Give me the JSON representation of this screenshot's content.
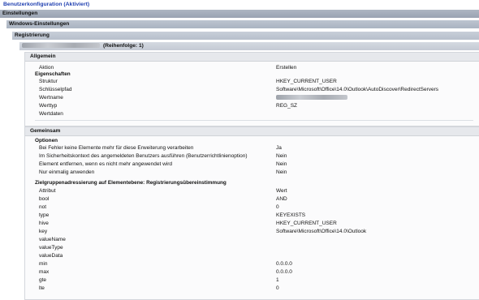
{
  "title": "Benutzerkonfiguration (Aktiviert)",
  "bands": {
    "einstellungen": "Einstellungen",
    "windows": "Windows-Einstellungen",
    "registrierung": "Registrierung",
    "item_suffix": "(Reihenfolge: 1)"
  },
  "allgemein": {
    "heading": "Allgemein",
    "aktion_label": "Aktion",
    "aktion_value": "Erstellen",
    "eigenschaften_heading": "Eigenschaften",
    "rows": [
      {
        "label": "Struktur",
        "value": "HKEY_CURRENT_USER"
      },
      {
        "label": "Schlüsselpfad",
        "value": "Software\\Microsoft\\Office\\14.0\\Outlook\\AutoDiscover\\RedirectServers"
      },
      {
        "label": "Wertname",
        "value": ""
      },
      {
        "label": "Werttyp",
        "value": "REG_SZ"
      },
      {
        "label": "Wertdaten",
        "value": ""
      }
    ]
  },
  "gemeinsam": {
    "heading": "Gemeinsam",
    "optionen_heading": "Optionen",
    "options": [
      {
        "label": "Bei Fehler keine Elemente mehr für diese Erweiterung verarbeiten",
        "value": "Ja"
      },
      {
        "label": "Im Sicherheitskontext des angemeldeten Benutzers ausführen (Benutzerrichtlinienoption)",
        "value": "Nein"
      },
      {
        "label": "Element entfernen, wenn es nicht mehr angewendet wird",
        "value": "Nein"
      },
      {
        "label": "Nur einmalig anwenden",
        "value": "Nein"
      }
    ],
    "ziel_heading": "Zielgruppenadressierung auf Elementebene: Registrierungsübereinstimmung",
    "ziel_header": {
      "label": "Attribut",
      "value": "Wert"
    },
    "ziel_rows": [
      {
        "label": "bool",
        "value": "AND"
      },
      {
        "label": "not",
        "value": "0"
      },
      {
        "label": "type",
        "value": "KEYEXISTS"
      },
      {
        "label": "hive",
        "value": "HKEY_CURRENT_USER"
      },
      {
        "label": "key",
        "value": "Software\\Microsoft\\Office\\14.0\\Outlook"
      },
      {
        "label": "valueName",
        "value": ""
      },
      {
        "label": "valueType",
        "value": ""
      },
      {
        "label": "valueData",
        "value": ""
      },
      {
        "label": "min",
        "value": "0.0.0.0"
      },
      {
        "label": "max",
        "value": "0.0.0.0"
      },
      {
        "label": "gte",
        "value": "1"
      },
      {
        "label": "lte",
        "value": "0"
      }
    ]
  }
}
